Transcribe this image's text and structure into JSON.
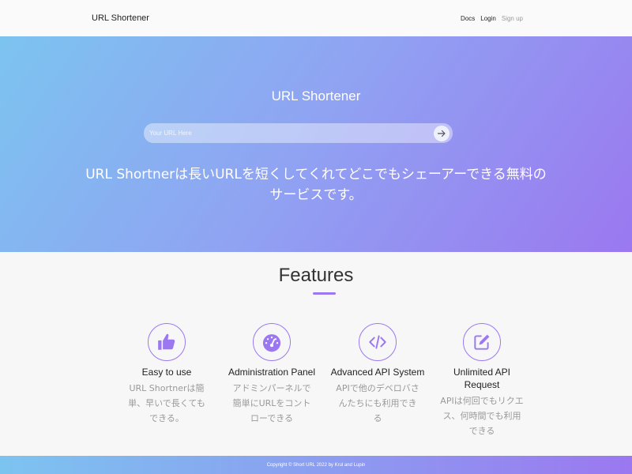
{
  "navbar": {
    "brand": "URL Shortener",
    "links": [
      {
        "label": "Docs"
      },
      {
        "label": "Login"
      },
      {
        "label": "Sign up"
      }
    ]
  },
  "hero": {
    "title": "URL Shortener",
    "search_placeholder": "Your URL Here",
    "search_value": "",
    "description": "URL Shortnerは長いURLを短くしてくれてどこでもシェーアーできる無料のサービスです。"
  },
  "features": {
    "title": "Features",
    "items": [
      {
        "icon": "thumbs-up-icon",
        "name": "Easy to use",
        "desc": "URL Shortnerは簡単、早いで長くてもできる。"
      },
      {
        "icon": "gauge-icon",
        "name": "Administration Panel",
        "desc": "アドミンパーネルで簡単にURLをコントローできる"
      },
      {
        "icon": "code-icon",
        "name": "Advanced API System",
        "desc": "APIで他のデベロバさんたちにも利用できる"
      },
      {
        "icon": "edit-icon",
        "name": "Unlimited API Request",
        "desc": "APIは何回でもリクエス、何時間でも利用できる"
      }
    ]
  },
  "footer": {
    "text": "Copyright © Short URL 2022 by Krul and Lupin"
  },
  "colors": {
    "accent": "#9b78f0",
    "gradient_start": "#7cc4f0",
    "gradient_end": "#9b78f0"
  }
}
